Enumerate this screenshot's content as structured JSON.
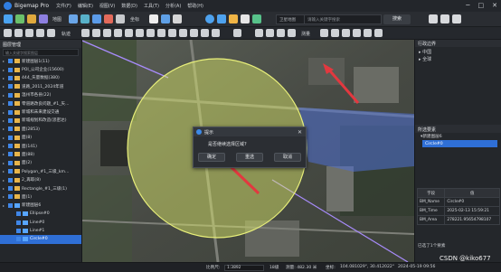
{
  "app": {
    "name": "Bigemap Pro"
  },
  "menu": [
    "文件(F)",
    "编辑(E)",
    "视图(V)",
    "数据(D)",
    "工具(T)",
    "分析(A)",
    "帮助(H)"
  ],
  "window_controls": [
    "minimize",
    "maximize",
    "close"
  ],
  "toolbar1": {
    "map_label": "地图",
    "map_source": "卫星地图",
    "search_placeholder": "请输入关键字搜索",
    "search_button": "搜索",
    "tools": [
      "坐标",
      "测量",
      "标注",
      "导出"
    ]
  },
  "toolbar2": {
    "labels": [
      "轨迹",
      "测量"
    ]
  },
  "layer_panel": {
    "title": "图层管理",
    "search_placeholder": "输入关键字搜索图层",
    "layers": [
      {
        "label": "新建图层1(11)",
        "checked": true,
        "icon": "folder"
      },
      {
        "label": "POI_公司企业(15600)",
        "checked": true,
        "icon": "folder"
      },
      {
        "label": "444_矢量数据(380)",
        "checked": true,
        "icon": "folder"
      },
      {
        "label": "道路_2011_2024年道",
        "checked": true,
        "icon": "folder"
      },
      {
        "label": "温州市各县(22)",
        "checked": true,
        "icon": "folder"
      },
      {
        "label": "零道路改良问题_#1_矢...",
        "checked": true,
        "icon": "folder"
      },
      {
        "label": "新城和未来建设交通",
        "checked": true,
        "icon": "folder"
      },
      {
        "label": "新城规划和改造(思密达)",
        "checked": true,
        "icon": "folder"
      },
      {
        "label": "面(2853)",
        "checked": true,
        "icon": "folder"
      },
      {
        "label": "面(8)",
        "checked": true,
        "icon": "folder"
      },
      {
        "label": "面(141)",
        "checked": true,
        "icon": "folder"
      },
      {
        "label": "面(88)",
        "checked": true,
        "icon": "folder"
      },
      {
        "label": "面(2)",
        "checked": true,
        "icon": "folder"
      },
      {
        "label": "Polygon_#1_三级_km...",
        "checked": true,
        "icon": "folder"
      },
      {
        "label": "2_再取(8)",
        "checked": true,
        "icon": "folder"
      },
      {
        "label": "Rectangle_#1_三级(1)",
        "checked": true,
        "icon": "folder"
      },
      {
        "label": "面(1)",
        "checked": true,
        "icon": "folder"
      },
      {
        "label": "新建图层6",
        "checked": true,
        "icon": "folder-blue"
      },
      {
        "label": "Ellipse#0",
        "checked": true,
        "icon": "item"
      },
      {
        "label": "Line#0",
        "checked": true,
        "icon": "item"
      },
      {
        "label": "Line#1",
        "checked": true,
        "icon": "item"
      },
      {
        "label": "Circle#0",
        "checked": true,
        "icon": "item",
        "selected": true
      }
    ]
  },
  "dialog": {
    "title": "提示",
    "message": "是否继续选择区域?",
    "buttons": [
      "确定",
      "重选",
      "取消"
    ]
  },
  "right_panel": {
    "title": "行政边界",
    "tree": [
      "中国",
      "全球"
    ],
    "feature_title": "所选要素",
    "feature_layer": "新建图层6",
    "feature_item": "Circle#0",
    "table_headers": [
      "字段",
      "值"
    ],
    "attributes": [
      {
        "field": "BM_Name",
        "value": "Circle#0"
      },
      {
        "field": "BM_Time",
        "value": "2025-02-13 15:59:21"
      },
      {
        "field": "BM_Area",
        "value": "278221.95654798107"
      }
    ],
    "footer": "已选了1个要素"
  },
  "status": {
    "scale_label": "比例尺:",
    "scale_value": "1:3892",
    "level": "18级",
    "length": "测量: 482.30 米",
    "coord_label": "坐标:",
    "coord_value": "104.081029°, 30.412022°",
    "datetime": "2024-05-19 09:56"
  },
  "watermark": "CSDN @kiko677",
  "colors": {
    "accent": "#2f6fd6",
    "circle_fill": "#e3ef6a",
    "polygon_fill": "#4f6fd4",
    "arrow": "#e2383f"
  }
}
